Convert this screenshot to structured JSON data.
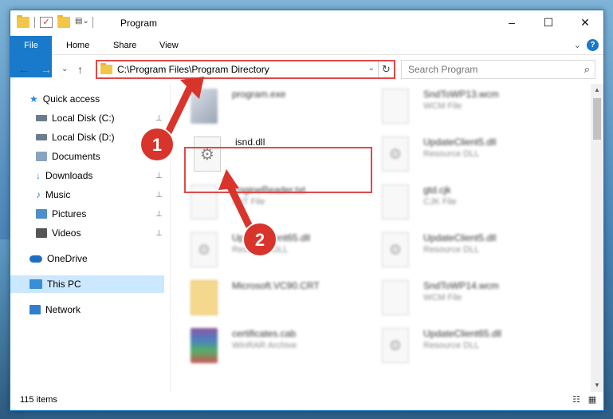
{
  "window": {
    "title": "Program",
    "controls": {
      "minimize": "–",
      "maximize": "☐",
      "close": "✕"
    }
  },
  "ribbon": {
    "tabs": [
      {
        "label": "File"
      },
      {
        "label": "Home"
      },
      {
        "label": "Share"
      },
      {
        "label": "View"
      }
    ],
    "expand_glyph": "⌄",
    "help_glyph": "?"
  },
  "nav": {
    "back": "←",
    "forward": "→",
    "recent": "⌄",
    "up": "↑"
  },
  "address": {
    "path": "C:\\Program Files\\Program Directory",
    "dropdown": "⌄",
    "refresh": "↻"
  },
  "search": {
    "placeholder": "Search Program",
    "icon_glyph": "⌕"
  },
  "sidebar": {
    "items": [
      {
        "label": "Quick access",
        "icon": "star-icon",
        "color": "#2e86de"
      },
      {
        "label": "Local Disk (C:)",
        "icon": "drive-icon",
        "color": "#6b7d8c"
      },
      {
        "label": "Local Disk (D:)",
        "icon": "drive-icon",
        "color": "#6b7d8c"
      },
      {
        "label": "Documents",
        "icon": "document-icon",
        "color": "#8aa3bf"
      },
      {
        "label": "Downloads",
        "icon": "download-icon",
        "color": "#2e86de"
      },
      {
        "label": "Music",
        "icon": "music-icon",
        "color": "#2e86de"
      },
      {
        "label": "Pictures",
        "icon": "picture-icon",
        "color": "#4d8fc9"
      },
      {
        "label": "Videos",
        "icon": "video-icon",
        "color": "#555555"
      },
      {
        "label": "OneDrive",
        "icon": "cloud-icon",
        "color": "#1e6fc4"
      },
      {
        "label": "This PC",
        "icon": "computer-icon",
        "color": "#3a8ed8"
      },
      {
        "label": "Network",
        "icon": "network-icon",
        "color": "#2f7fd0"
      }
    ],
    "pin_glyph": "📌",
    "selected_color": "#cce8ff"
  },
  "files": [
    {
      "name": "program.exe",
      "type": "",
      "icon": "program-exe-icon"
    },
    {
      "name": "SndToWP13.wcm",
      "type": "WCM File",
      "icon": "blank-file-icon"
    },
    {
      "name": "isnd.dll",
      "type": "",
      "icon": "dll-gear-icon"
    },
    {
      "name": "UpdateClient5.dll",
      "type": "Resource DLL",
      "icon": "dll-gear-icon"
    },
    {
      "name": "EngineReader.txt",
      "type": "TXT File",
      "icon": "text-file-icon"
    },
    {
      "name": "gtd.cjk",
      "type": "CJK File",
      "icon": "blank-file-icon"
    },
    {
      "name": "UpdateClient65.dll",
      "type": "Resource DLL",
      "icon": "dll-gear-icon"
    },
    {
      "name": "UpdateClient5.dll",
      "type": "Resource DLL",
      "icon": "dll-gear-icon"
    },
    {
      "name": "Microsoft.VC90.CRT",
      "type": "",
      "icon": "folder-icon"
    },
    {
      "name": "SndToWP14.wcm",
      "type": "WCM File",
      "icon": "blank-file-icon"
    },
    {
      "name": "certificates.cab",
      "type": "WinRAR Archive",
      "icon": "winrar-icon"
    },
    {
      "name": "UpdateClient65.dll",
      "type": "Resource DLL",
      "icon": "dll-gear-icon"
    }
  ],
  "status": {
    "item_count": "115 items",
    "view_details": "☷",
    "view_icons": "▦"
  },
  "annotations": [
    {
      "number": "1",
      "color": "#d8342c"
    },
    {
      "number": "2",
      "color": "#d8342c"
    }
  ],
  "colors": {
    "accent": "#1979ca",
    "highlight": "#e34848",
    "folder": "#f3c64a"
  }
}
